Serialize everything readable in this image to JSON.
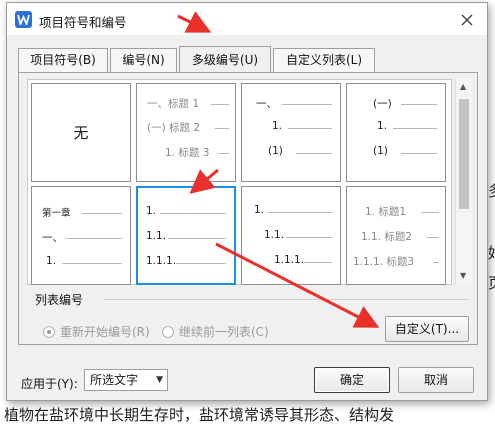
{
  "dialog": {
    "title": "项目符号和编号",
    "close_glyph": "✕"
  },
  "tabs": [
    {
      "label": "项目符号(B)",
      "active": false
    },
    {
      "label": "编号(N)",
      "active": false
    },
    {
      "label": "多级编号(U)",
      "active": true
    },
    {
      "label": "自定义列表(L)",
      "active": false
    }
  ],
  "styles": [
    {
      "type": "none",
      "label": "无"
    },
    {
      "type": "list",
      "levels": [
        "一、标题 1",
        "(一) 标题 2",
        "1. 标题 3"
      ]
    },
    {
      "type": "list",
      "levels": [
        "一、",
        "1.",
        "(1)"
      ]
    },
    {
      "type": "list",
      "levels": [
        "(一)",
        "1.",
        "(1)"
      ]
    },
    {
      "type": "list",
      "levels": [
        "第一章",
        "一、",
        "1."
      ]
    },
    {
      "type": "list",
      "selected": true,
      "levels": [
        "1.",
        "1.1.",
        "1.1.1."
      ]
    },
    {
      "type": "list",
      "levels": [
        "1.",
        "1.1.",
        "1.1.1."
      ]
    },
    {
      "type": "list",
      "levels": [
        "1. 标题1",
        "1.1. 标题2",
        "1.1.1. 标题3"
      ]
    }
  ],
  "list_numbering": {
    "section_label": "列表编号",
    "restart_label": "重新开始编号(R)",
    "continue_label": "继续前一列表(C)",
    "custom_button": "自定义(T)..."
  },
  "apply": {
    "label": "应用于(Y):",
    "value": "所选文字"
  },
  "buttons": {
    "ok": "确定",
    "cancel": "取消"
  },
  "document": {
    "bottom_text": "植物在盐环境中长期生存时，盐环境常诱导其形态、结构发"
  },
  "colors": {
    "accent": "#1e8fe1",
    "annotation_arrow": "#e8312a",
    "app_icon": "#2b6fd8"
  }
}
